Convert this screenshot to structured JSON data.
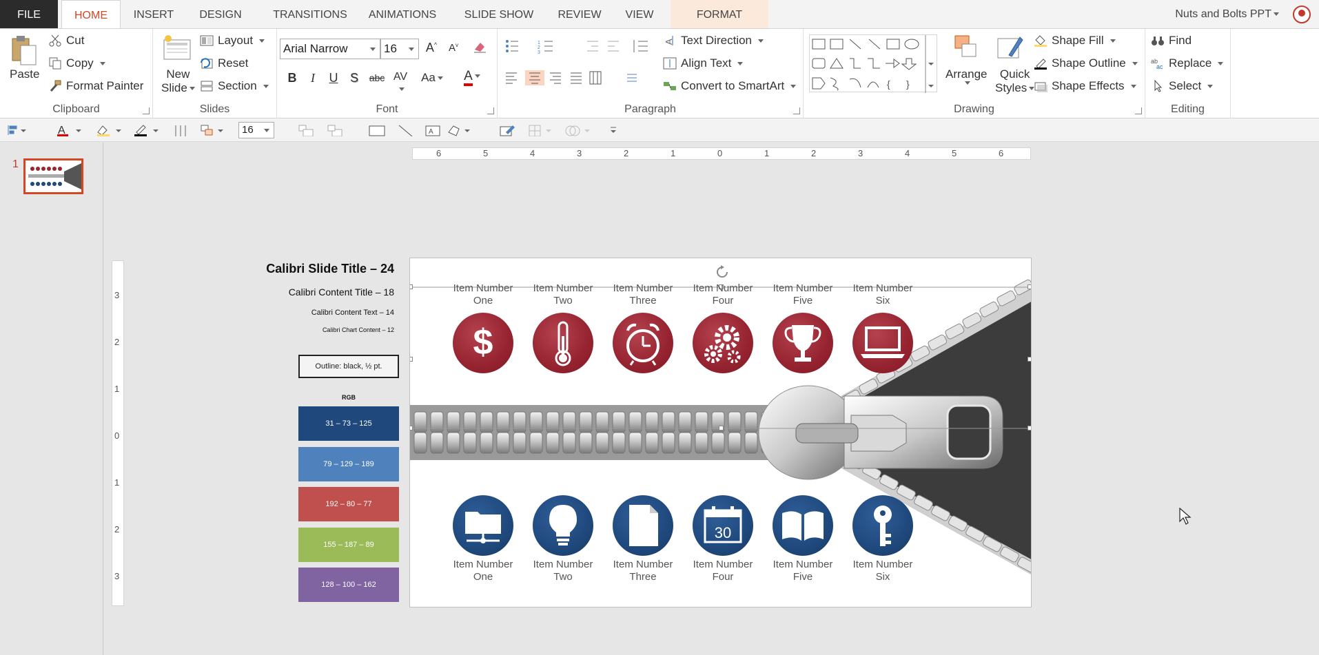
{
  "tabs": {
    "file": "FILE",
    "home": "HOME",
    "insert": "INSERT",
    "design": "DESIGN",
    "transitions": "TRANSITIONS",
    "animations": "ANIMATIONS",
    "slideshow": "SLIDE SHOW",
    "review": "REVIEW",
    "view": "VIEW",
    "format": "FORMAT"
  },
  "account": {
    "name": "Nuts and Bolts PPT"
  },
  "clipboard": {
    "label": "Clipboard",
    "paste": "Paste",
    "cut": "Cut",
    "copy": "Copy",
    "format_painter": "Format Painter"
  },
  "slides": {
    "label": "Slides",
    "new_slide_1": "New",
    "new_slide_2": "Slide",
    "layout": "Layout",
    "reset": "Reset",
    "section": "Section"
  },
  "font": {
    "label": "Font",
    "name": "Arial Narrow",
    "size": "16",
    "bold": "B",
    "italic": "I",
    "underline": "U",
    "shadow": "S",
    "strike": "abc",
    "spacing": "AV",
    "case": "Aa",
    "color": "A",
    "grow": "A",
    "shrink": "A"
  },
  "paragraph": {
    "label": "Paragraph",
    "text_direction": "Text Direction",
    "align_text": "Align Text",
    "convert_smartart": "Convert to SmartArt"
  },
  "drawing": {
    "label": "Drawing",
    "arrange": "Arrange",
    "quick_styles_1": "Quick",
    "quick_styles_2": "Styles",
    "shape_fill": "Shape Fill",
    "shape_outline": "Shape Outline",
    "shape_effects": "Shape Effects"
  },
  "editing": {
    "label": "Editing",
    "find": "Find",
    "replace": "Replace",
    "select": "Select"
  },
  "quick_toolbar": {
    "font_size": "16"
  },
  "thumbs": {
    "slide_number": "1"
  },
  "ruler": {
    "h_labels": [
      "6",
      "5",
      "4",
      "3",
      "2",
      "1",
      "0",
      "1",
      "2",
      "3",
      "4",
      "5",
      "6"
    ],
    "v_labels": [
      "3",
      "2",
      "1",
      "0",
      "1",
      "2",
      "3"
    ]
  },
  "legend": {
    "slide_title": "Calibri  Slide Title – 24",
    "content_title": "Calibri Content Title – 18",
    "content_text": "Calibri  Content  Text – 14",
    "chart_content": "Calibri Chart  Content – 12",
    "outline": "Outline: black, ½ pt.",
    "rgb_label": "RGB",
    "swatches": [
      {
        "label": "31 – 73 – 125",
        "color": "#1f497d"
      },
      {
        "label": "79 – 129 – 189",
        "color": "#4f81bd"
      },
      {
        "label": "192 – 80 – 77",
        "color": "#c0504d"
      },
      {
        "label": "155 – 187 – 89",
        "color": "#9bbb59"
      },
      {
        "label": "128 – 100 – 162",
        "color": "#8064a2"
      }
    ]
  },
  "slide": {
    "top_items": [
      {
        "line1": "Item Number",
        "line2": "One",
        "icon": "dollar-icon"
      },
      {
        "line1": "Item Number",
        "line2": "Two",
        "icon": "thermometer-icon"
      },
      {
        "line1": "Item Number",
        "line2": "Three",
        "icon": "alarm-clock-icon"
      },
      {
        "line1": "Item Number",
        "line2": "Four",
        "icon": "gears-icon"
      },
      {
        "line1": "Item Number",
        "line2": "Five",
        "icon": "trophy-icon"
      },
      {
        "line1": "Item Number",
        "line2": "Six",
        "icon": "laptop-icon"
      }
    ],
    "bottom_items": [
      {
        "line1": "Item Number",
        "line2": "One",
        "icon": "folder-network-icon"
      },
      {
        "line1": "Item Number",
        "line2": "Two",
        "icon": "lightbulb-icon"
      },
      {
        "line1": "Item Number",
        "line2": "Three",
        "icon": "document-icon"
      },
      {
        "line1": "Item Number",
        "line2": "Four",
        "icon": "calendar-icon"
      },
      {
        "line1": "Item Number",
        "line2": "Five",
        "icon": "book-icon"
      },
      {
        "line1": "Item Number",
        "line2": "Six",
        "icon": "key-icon"
      }
    ],
    "calendar_day": "30",
    "colors": {
      "red": "#962330",
      "blue": "#1f497d",
      "zipper_dark": "#3c3c3c",
      "zipper_light": "#c8c8c8"
    }
  }
}
